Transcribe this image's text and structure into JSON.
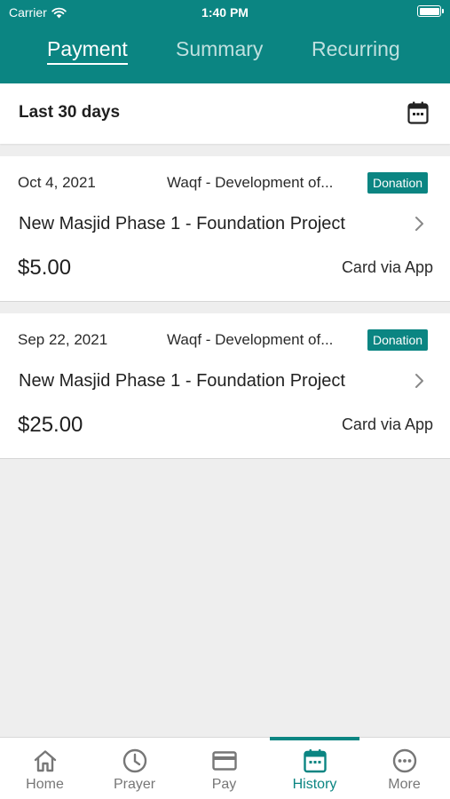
{
  "status_bar": {
    "carrier": "Carrier",
    "time": "1:40 PM"
  },
  "tabs": [
    {
      "label": "Payment",
      "active": true
    },
    {
      "label": "Summary",
      "active": false
    },
    {
      "label": "Recurring",
      "active": false
    }
  ],
  "filter": {
    "label": "Last 30 days",
    "icon": "calendar-icon"
  },
  "transactions": [
    {
      "date": "Oct 4, 2021",
      "fund": "Waqf - Development of...",
      "badge": "Donation",
      "project": "New Masjid Phase 1 - Foundation Project",
      "amount": "$5.00",
      "method": "Card via App"
    },
    {
      "date": "Sep 22, 2021",
      "fund": "Waqf - Development of...",
      "badge": "Donation",
      "project": "New Masjid Phase 1 - Foundation Project",
      "amount": "$25.00",
      "method": "Card via App"
    }
  ],
  "bottom_nav": [
    {
      "label": "Home",
      "icon": "home-icon",
      "active": false
    },
    {
      "label": "Prayer",
      "icon": "clock-icon",
      "active": false
    },
    {
      "label": "Pay",
      "icon": "card-icon",
      "active": false
    },
    {
      "label": "History",
      "icon": "calendar-icon",
      "active": true
    },
    {
      "label": "More",
      "icon": "more-icon",
      "active": false
    }
  ],
  "colors": {
    "brand": "#0b8582",
    "background": "#eeeeee",
    "inactive": "#777777"
  }
}
